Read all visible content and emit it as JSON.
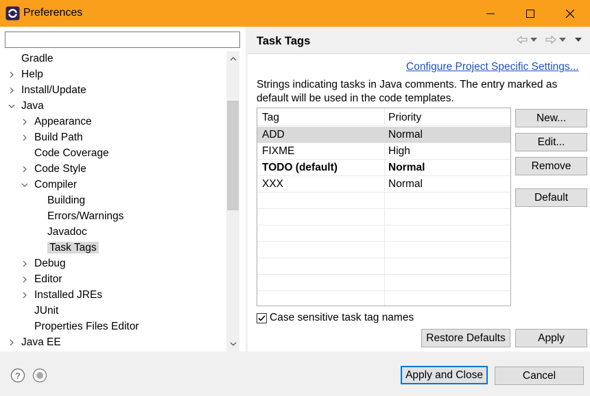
{
  "window": {
    "title": "Preferences"
  },
  "filter": {
    "value": ""
  },
  "tree": [
    {
      "label": "Gradle",
      "chevron": ""
    },
    {
      "label": "Help",
      "chevron": ">"
    },
    {
      "label": "Install/Update",
      "chevron": ">"
    },
    {
      "label": "Java",
      "chevron": "v"
    },
    {
      "label": "Appearance",
      "chevron": ">"
    },
    {
      "label": "Build Path",
      "chevron": ">"
    },
    {
      "label": "Code Coverage",
      "chevron": ""
    },
    {
      "label": "Code Style",
      "chevron": ">"
    },
    {
      "label": "Compiler",
      "chevron": "v"
    },
    {
      "label": "Building",
      "chevron": ""
    },
    {
      "label": "Errors/Warnings",
      "chevron": ""
    },
    {
      "label": "Javadoc",
      "chevron": ""
    },
    {
      "label": "Task Tags",
      "chevron": "",
      "selected": true
    },
    {
      "label": "Debug",
      "chevron": ">"
    },
    {
      "label": "Editor",
      "chevron": ">"
    },
    {
      "label": "Installed JREs",
      "chevron": ">"
    },
    {
      "label": "JUnit",
      "chevron": ""
    },
    {
      "label": "Properties Files Editor",
      "chevron": ""
    },
    {
      "label": "Java EE",
      "chevron": ">"
    }
  ],
  "page": {
    "title": "Task Tags",
    "config_link": "Configure Project Specific Settings...",
    "description": "Strings indicating tasks in Java comments. The entry marked as default will be used in the code templates.",
    "table": {
      "headers": [
        "Tag",
        "Priority"
      ],
      "rows": [
        {
          "tag": "ADD",
          "priority": "Normal",
          "selected": true
        },
        {
          "tag": "FIXME",
          "priority": "High"
        },
        {
          "tag": "TODO (default)",
          "priority": "Normal",
          "bold": true
        },
        {
          "tag": "XXX",
          "priority": "Normal"
        }
      ]
    },
    "buttons": {
      "new": "New...",
      "edit": "Edit...",
      "remove": "Remove",
      "default": "Default"
    },
    "case_sensitive": {
      "label": "Case sensitive task tag names",
      "checked": true
    },
    "restore_defaults": "Restore Defaults",
    "apply": "Apply"
  },
  "footer": {
    "apply_and_close": "Apply and Close",
    "cancel": "Cancel"
  },
  "colors": {
    "titlebar": "#f99f1c",
    "link": "#1a52c7",
    "focus": "#0078d7",
    "selection": "#d9d9d9"
  }
}
